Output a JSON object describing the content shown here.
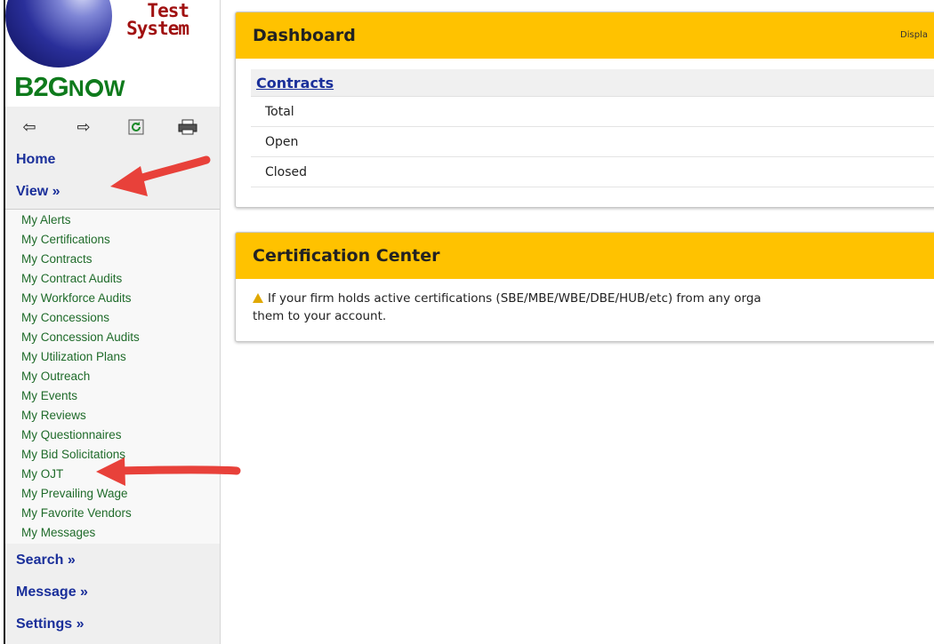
{
  "app": {
    "logo_line1": "Test",
    "logo_line2": "System",
    "brand_b2g": "B2G",
    "brand_n": "N",
    "brand_w": "W"
  },
  "toolbar": {
    "icons": [
      "back-arrow-icon",
      "forward-arrow-icon",
      "refresh-icon",
      "print-icon"
    ],
    "back": "⇦",
    "forward": "⇨",
    "refresh": "⟳",
    "print": "⎙"
  },
  "sidebar": {
    "home_label": "Home",
    "view_label": "View »",
    "view_items": [
      "My Alerts",
      "My Certifications",
      "My Contracts",
      "My Contract Audits",
      "My Workforce Audits",
      "My Concessions",
      "My Concession Audits",
      "My Utilization Plans",
      "My Outreach",
      "My Events",
      "My Reviews",
      "My Questionnaires",
      "My Bid Solicitations",
      "My OJT",
      "My Prevailing Wage",
      "My Favorite Vendors",
      "My Messages"
    ],
    "search_label": "Search »",
    "message_label": "Message »",
    "settings_label": "Settings »"
  },
  "dashboard": {
    "title": "Dashboard",
    "display_text": "Displa",
    "contracts_header": "Contracts",
    "rows": [
      "Total",
      "Open",
      "Closed"
    ]
  },
  "certification": {
    "title": "Certification Center",
    "line1": "If your firm holds active certifications (SBE/MBE/WBE/DBE/HUB/etc) from any orga",
    "line2": "them to your account."
  },
  "colors": {
    "accent_yellow": "#ffc200",
    "nav_blue": "#1a2f9a",
    "link_green": "#1f6b2a",
    "arrow_red": "#e8413a"
  }
}
